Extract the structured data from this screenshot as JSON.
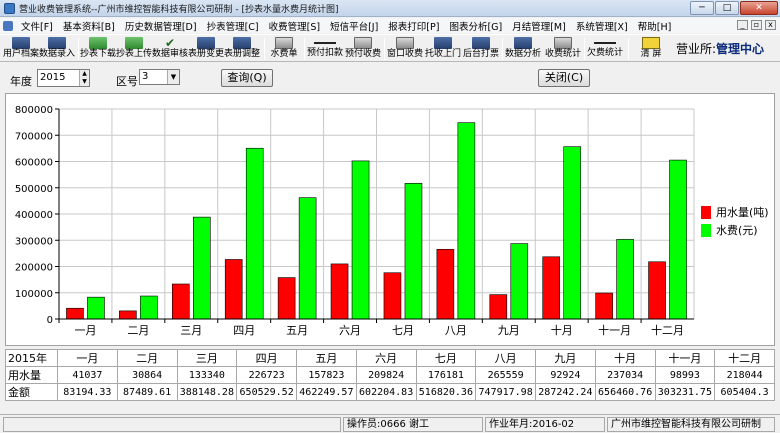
{
  "window": {
    "title": "营业收费管理系统--广州市维控智能科技有限公司研制 - [抄表水量水费月统计图]",
    "min_label": "─",
    "max_label": "□",
    "close_label": "✕"
  },
  "menu": [
    "文件[F]",
    "基本资料[B]",
    "历史数据管理[D]",
    "抄表管理[C]",
    "收费管理[S]",
    "短信平台[J]",
    "报表打印[P]",
    "图表分析[G]",
    "月结管理[M]",
    "系统管理[X]",
    "帮助[H]"
  ],
  "menu_mdi": {
    "min": "_",
    "restore": "▫",
    "close": "x"
  },
  "toolbar": {
    "buttons": [
      "用户档案",
      "数据录入",
      "抄表下载",
      "抄表上传",
      "数据审核",
      "表册变更",
      "表册调整",
      "水费单",
      "预付扣款",
      "预付收费",
      "窗口收费",
      "托收上门",
      "后台打票",
      "数据分析",
      "收费统计",
      "欠费统计",
      "清  屏"
    ],
    "biz_label": "营业所:",
    "biz_value": "管理中心"
  },
  "query": {
    "year_label": "年度",
    "year_value": "2015",
    "zone_label": "区号",
    "zone_value": "3",
    "query_button": "查询(Q)",
    "close_button": "关闭(C)"
  },
  "colors": {
    "water_volume": "#ff0000",
    "water_fee": "#00ff00"
  },
  "chart_data": {
    "type": "bar",
    "categories": [
      "一月",
      "二月",
      "三月",
      "四月",
      "五月",
      "六月",
      "七月",
      "八月",
      "九月",
      "十月",
      "十一月",
      "十二月"
    ],
    "series": [
      {
        "name": "用水量(吨)",
        "values": [
          41037,
          30864,
          133340,
          226723,
          157823,
          209824,
          176181,
          265559,
          92924,
          237034,
          98993,
          218044
        ]
      },
      {
        "name": "水费(元)",
        "values": [
          83194.33,
          87489.61,
          388148.28,
          650529.52,
          462249.57,
          602204.83,
          516820.36,
          747917.98,
          287242.24,
          656460.76,
          303231.75,
          605404.3
        ]
      }
    ],
    "ylim": [
      0,
      800000
    ],
    "yticks": [
      "0",
      "100000",
      "200000",
      "300000",
      "400000",
      "500000",
      "600000",
      "700000",
      "800000"
    ],
    "grid": true,
    "legend": "right"
  },
  "table": {
    "year_cell": "2015年",
    "months": [
      "一月",
      "二月",
      "三月",
      "四月",
      "五月",
      "六月",
      "七月",
      "八月",
      "九月",
      "十月",
      "十一月",
      "十二月"
    ],
    "volume_label": "用水量",
    "volume": [
      "41037",
      "30864",
      "133340",
      "226723",
      "157823",
      "209824",
      "176181",
      "265559",
      "92924",
      "237034",
      "98993",
      "218044"
    ],
    "amount_label": "金额",
    "amount": [
      "83194.33",
      "87489.61",
      "388148.28",
      "650529.52",
      "462249.57",
      "602204.83",
      "516820.36",
      "747917.98",
      "287242.24",
      "656460.76",
      "303231.75",
      "605404.3"
    ]
  },
  "status": {
    "operator": "操作员:0666 谢工",
    "period": "作业年月:2016-02",
    "company": "广州市维控智能科技有限公司研制"
  }
}
